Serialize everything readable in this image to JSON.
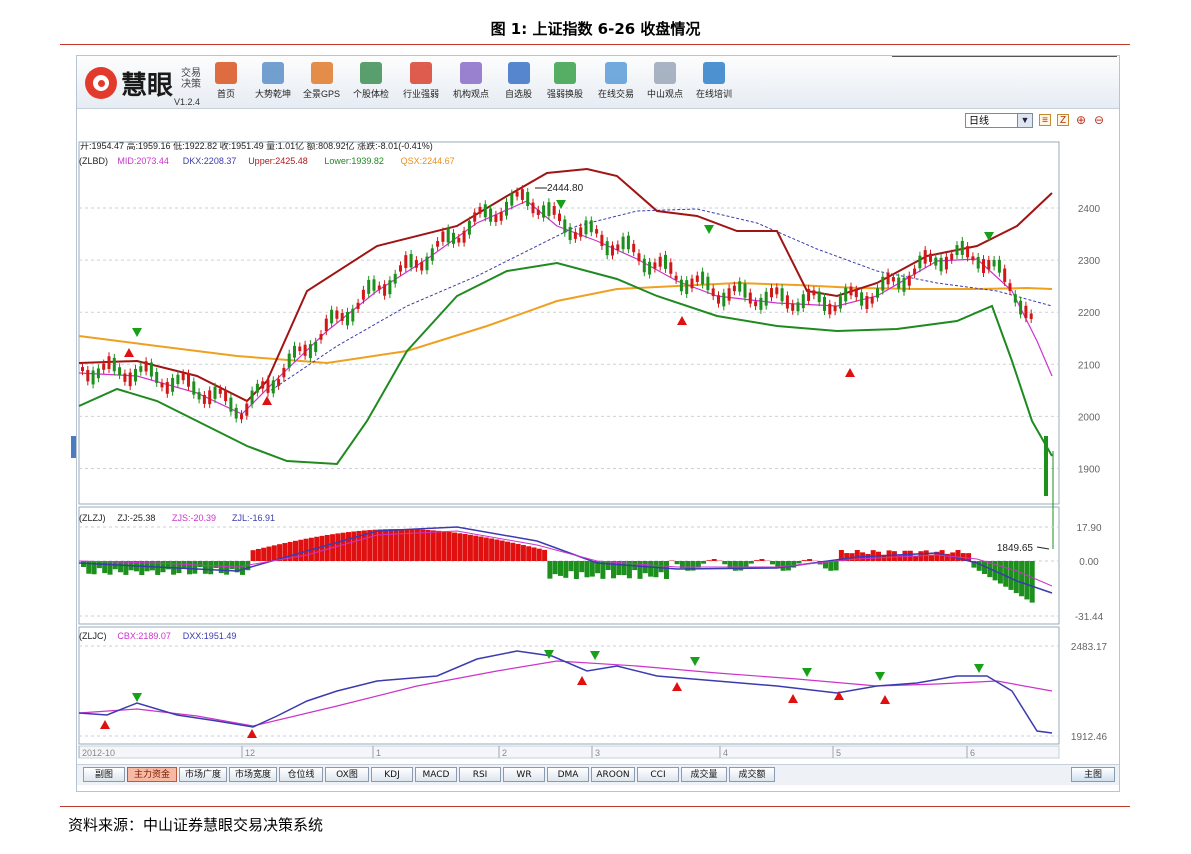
{
  "caption": "图 1: 上证指数 6-26 收盘情况",
  "source": "资料来源：中山证券慧眼交易决策系统",
  "app": {
    "logo": "慧眼",
    "logo_sub1": "交易",
    "logo_sub2": "决策",
    "version": "V1.2.4"
  },
  "toolbar": [
    {
      "label": "首页",
      "icon": "home-icon",
      "color": "#d9531e"
    },
    {
      "label": "大势乾坤",
      "icon": "magnifier-icon",
      "color": "#5a8fc8"
    },
    {
      "label": "全景GPS",
      "icon": "grid-icon",
      "color": "#e07a2a"
    },
    {
      "label": "个股体检",
      "icon": "checkup-icon",
      "color": "#3d8f55"
    },
    {
      "label": "行业强弱",
      "icon": "bar-icon",
      "color": "#d8412f"
    },
    {
      "label": "机构观点",
      "icon": "people-icon",
      "color": "#8a6cc8"
    },
    {
      "label": "自选股",
      "icon": "briefcase-icon",
      "color": "#3a72c4"
    },
    {
      "label": "强弱换股",
      "icon": "swap-icon",
      "color": "#3aa04a"
    },
    {
      "label": "在线交易",
      "icon": "cart-icon",
      "color": "#5a9bd8"
    },
    {
      "label": "中山观点",
      "icon": "document-icon",
      "color": "#9aa7b8"
    },
    {
      "label": "在线培训",
      "icon": "monitor-icon",
      "color": "#2f7fc9"
    }
  ],
  "period": {
    "value": "日线"
  },
  "info_line": "开:1954.47 高:1959.16 低:1922.82 收:1951.49 量:1.01亿 额:808.92亿 涨跌:-8.01(-0.41%)",
  "panel1": {
    "legend": [
      {
        "text": "(ZLBD)",
        "color": "#222222"
      },
      {
        "text": "MID:2073.44",
        "color": "#cc33cc"
      },
      {
        "text": "DKX:2208.37",
        "color": "#3b3bb0"
      },
      {
        "text": "Upper:2425.48",
        "color": "#b01818"
      },
      {
        "text": "Lower:1939.82",
        "color": "#1f8a1f"
      },
      {
        "text": "QSX:2244.67",
        "color": "#e89020"
      }
    ],
    "y_ticks": [
      "2400",
      "2300",
      "2200",
      "2100",
      "2000",
      "1900"
    ],
    "high_label": "2444.80",
    "low_label": "1849.65"
  },
  "panel2": {
    "legend": [
      {
        "text": "(ZLZJ)",
        "color": "#222222"
      },
      {
        "text": "ZJ:-25.38",
        "color": "#222222"
      },
      {
        "text": "ZJS:-20.39",
        "color": "#cc33cc"
      },
      {
        "text": "ZJL:-16.91",
        "color": "#3b3bb0"
      }
    ],
    "y_ticks": [
      "17.90",
      "0.00",
      "-31.44"
    ]
  },
  "panel3": {
    "legend": [
      {
        "text": "(ZLJC)",
        "color": "#222222"
      },
      {
        "text": "CBX:2189.07",
        "color": "#cc33cc"
      },
      {
        "text": "DXX:1951.49",
        "color": "#3b3bb0"
      }
    ],
    "y_ticks": [
      "2483.17",
      "1912.46"
    ]
  },
  "date_axis": [
    "2012-10",
    "12",
    "1",
    "2",
    "3",
    "4",
    "5",
    "6"
  ],
  "tabs": [
    "副图",
    "主力资金",
    "市场广度",
    "市场宽度",
    "仓位线",
    "OX图",
    "KDJ",
    "MACD",
    "RSI",
    "WR",
    "DMA",
    "AROON",
    "CCI",
    "成交量",
    "成交额"
  ],
  "main_tab": "主图",
  "colors": {
    "up": "#e0201a",
    "down": "#1d8f1d",
    "accent_red": "#c0392b"
  }
}
